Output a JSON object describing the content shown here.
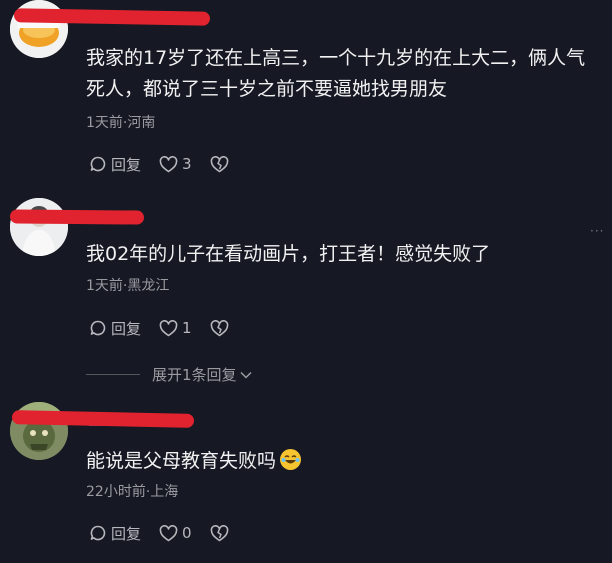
{
  "comments": [
    {
      "text": "我家的17岁了还在上高三，一个十九岁的在上大二，俩人气死人，都说了三十岁之前不要逼她找男朋友",
      "meta": "1天前·河南",
      "reply_label": "回复",
      "like_count": "3"
    },
    {
      "text": "我02年的儿子在看动画片，打王者！感觉失败了",
      "meta": "1天前·黑龙江",
      "reply_label": "回复",
      "like_count": "1",
      "more": "···"
    },
    {
      "text": "能说是父母教育失败吗",
      "emoji_icon": "laughing-crying-emoji-icon",
      "meta": "22小时前·上海",
      "reply_label": "回复",
      "like_count": "0"
    }
  ],
  "expand_replies": "展开1条回复",
  "colors": {
    "background": "#161823",
    "redaction": "#e0232e",
    "meta": "#9a9ba1"
  }
}
